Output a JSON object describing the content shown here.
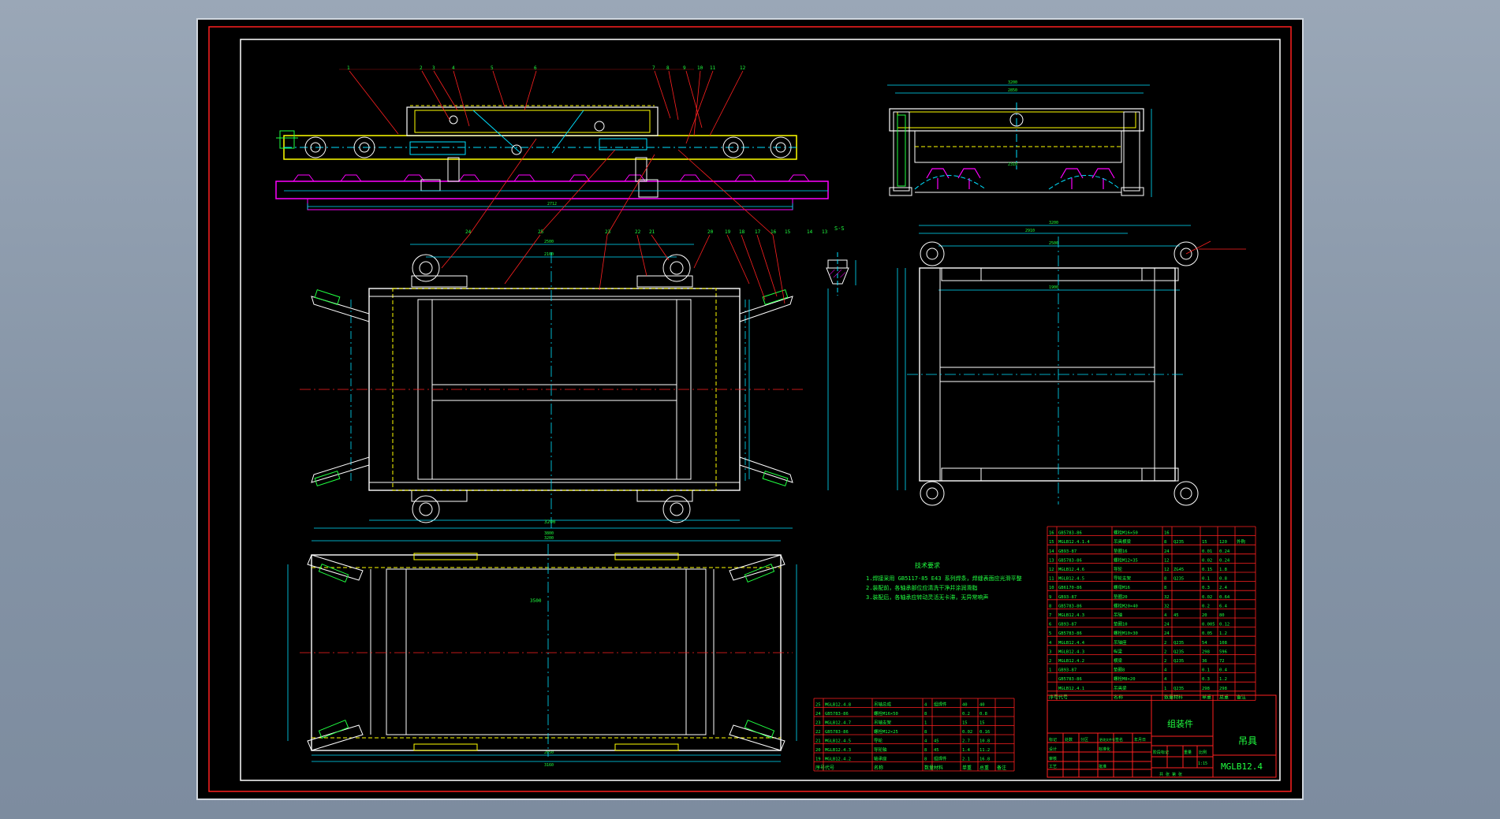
{
  "drawing": {
    "title": "吊具",
    "drawing_no": "MGLB12.4",
    "assembly_label": "组装件",
    "tech_title": "技术要求",
    "tech_notes": [
      "1.焊接采用 GB5117-85 E43 系列焊条，焊缝表面应光滑平整",
      "2.装配前，各轴承部位应清洗干净并涂润滑脂",
      "3.装配后，各轴承应转动灵活无卡滞，无异常响声"
    ],
    "callouts_top": [
      "1",
      "2",
      "3",
      "4",
      "5",
      "6",
      "7",
      "8",
      "9",
      "10",
      "11",
      "12"
    ],
    "callouts_mid": [
      "24",
      "25",
      "23",
      "22",
      "21",
      "20",
      "19",
      "18",
      "17",
      "16",
      "15",
      "14",
      "13"
    ],
    "section_label": "S-S"
  },
  "bom_right": {
    "rows": [
      {
        "no": "16",
        "code": "GB5783-86",
        "name": "螺栓M16×50",
        "qty": "16",
        "mat": "",
        "w1": "",
        "w2": "",
        "note": ""
      },
      {
        "no": "15",
        "code": "MGLB12.4.1.4",
        "name": "吊具横梁",
        "qty": "8",
        "mat": "Q235",
        "w1": "15",
        "w2": "120",
        "note": "外购"
      },
      {
        "no": "14",
        "code": "GB93-87",
        "name": "垫圈16",
        "qty": "24",
        "mat": "",
        "w1": "0.01",
        "w2": "0.24",
        "note": ""
      },
      {
        "no": "13",
        "code": "GB5783-86",
        "name": "螺栓M12×35",
        "qty": "12",
        "mat": "",
        "w1": "0.02",
        "w2": "0.24",
        "note": ""
      },
      {
        "no": "12",
        "code": "MGLB12.4.6",
        "name": "导轮",
        "qty": "12",
        "mat": "ZG45",
        "w1": "0.15",
        "w2": "1.8",
        "note": ""
      },
      {
        "no": "11",
        "code": "MGLB12.4.5",
        "name": "导轮支架",
        "qty": "8",
        "mat": "Q235",
        "w1": "0.1",
        "w2": "0.8",
        "note": ""
      },
      {
        "no": "10",
        "code": "GB6170-86",
        "name": "螺母M16",
        "qty": "8",
        "mat": "",
        "w1": "0.3",
        "w2": "2.4",
        "note": ""
      },
      {
        "no": "9",
        "code": "GB93-87",
        "name": "垫圈20",
        "qty": "32",
        "mat": "",
        "w1": "0.02",
        "w2": "0.64",
        "note": ""
      },
      {
        "no": "8",
        "code": "GB5783-86",
        "name": "螺栓M20×40",
        "qty": "32",
        "mat": "",
        "w1": "0.2",
        "w2": "6.4",
        "note": ""
      },
      {
        "no": "7",
        "code": "MGLB12.4.3",
        "name": "吊轴",
        "qty": "4",
        "mat": "45",
        "w1": "20",
        "w2": "80",
        "note": ""
      },
      {
        "no": "6",
        "code": "GB93-87",
        "name": "垫圈10",
        "qty": "24",
        "mat": "",
        "w1": "0.005",
        "w2": "0.12",
        "note": ""
      },
      {
        "no": "5",
        "code": "GB5783-86",
        "name": "螺栓M10×30",
        "qty": "24",
        "mat": "",
        "w1": "0.05",
        "w2": "1.2",
        "note": ""
      },
      {
        "no": "4",
        "code": "MGLB12.4.4",
        "name": "吊轴座",
        "qty": "2",
        "mat": "Q235",
        "w1": "54",
        "w2": "108",
        "note": ""
      },
      {
        "no": "3",
        "code": "MGLB12.4.3",
        "name": "纵梁",
        "qty": "2",
        "mat": "Q235",
        "w1": "298",
        "w2": "596",
        "note": ""
      },
      {
        "no": "2",
        "code": "MGLB12.4.2",
        "name": "横梁",
        "qty": "2",
        "mat": "Q235",
        "w1": "36",
        "w2": "72",
        "note": ""
      },
      {
        "no": "1",
        "code": "GB93-87",
        "name": "垫圈8",
        "qty": "4",
        "mat": "",
        "w1": "0.1",
        "w2": "0.4",
        "note": ""
      },
      {
        "no": "",
        "code": "GB5783-86",
        "name": "螺栓M8×20",
        "qty": "4",
        "mat": "",
        "w1": "0.3",
        "w2": "1.2",
        "note": ""
      },
      {
        "no": "",
        "code": "MGLB12.4.1",
        "name": "吊具梁",
        "qty": "1",
        "mat": "Q235",
        "w1": "298",
        "w2": "298",
        "note": ""
      }
    ],
    "header": [
      "序号",
      "代号",
      "名称",
      "数量",
      "材料",
      "单重",
      "总重",
      "备注"
    ]
  },
  "bom_left": {
    "rows": [
      {
        "no": "25",
        "code": "MGLB12.4.8",
        "name": "吊轴总成",
        "qty": "4",
        "mat": "组焊件",
        "w1": "40",
        "w2": "40"
      },
      {
        "no": "24",
        "code": "GB5783-86",
        "name": "螺栓M16×50",
        "qty": "8",
        "mat": "",
        "w1": "0.2",
        "w2": "0.8"
      },
      {
        "no": "23",
        "code": "MGLB12.4.7",
        "name": "吊轴支架",
        "qty": "1",
        "mat": "",
        "w1": "15",
        "w2": "15"
      },
      {
        "no": "22",
        "code": "GB5783-86",
        "name": "螺栓M12×25",
        "qty": "8",
        "mat": "",
        "w1": "0.02",
        "w2": "0.16"
      },
      {
        "no": "21",
        "code": "MGLB12.4.5",
        "name": "导轮",
        "qty": "4",
        "mat": "45",
        "w1": "2.7",
        "w2": "10.8"
      },
      {
        "no": "20",
        "code": "MGLB12.4.3",
        "name": "导轮轴",
        "qty": "8",
        "mat": "45",
        "w1": "1.4",
        "w2": "11.2"
      },
      {
        "no": "19",
        "code": "MGLB12.4.2",
        "name": "轴承座",
        "qty": "8",
        "mat": "组焊件",
        "w1": "2.1",
        "w2": "16.8"
      }
    ],
    "header": [
      "序号",
      "代号",
      "名称",
      "数量",
      "材料",
      "单重",
      "总重",
      "备注"
    ]
  },
  "title_block": {
    "rows_label": [
      "标记",
      "处数",
      "分区",
      "更改文件号",
      "签名",
      "年月日"
    ],
    "design": "设计",
    "check": "审核",
    "process": "工艺",
    "standard": "标准化",
    "approve": "批准",
    "stage": "阶段标记",
    "weight": "重量",
    "scale": "比例",
    "scale_val": "1:15",
    "sheet": "共 张 第 张"
  },
  "colors": {
    "background": "#000000",
    "border": "#ff2020",
    "frame": "#ffffff",
    "table": "#ff2020",
    "text": "#20ff40",
    "cyan": "#00e0ff",
    "yellow": "#ffff00",
    "magenta": "#ff00ff",
    "leader": "#ff2020"
  }
}
